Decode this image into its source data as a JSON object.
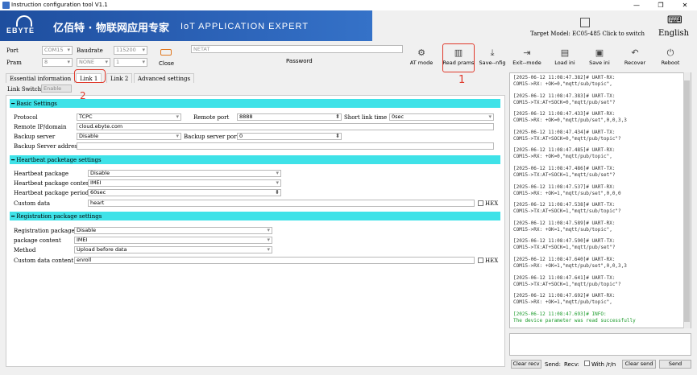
{
  "window": {
    "title": "Instruction configuration tool V1.1",
    "min": "—",
    "max": "❐",
    "close": "✕"
  },
  "banner": {
    "logo_text": "EBYTE",
    "cn_name": "亿佰特 · 物联网应用专家",
    "en_slogan": "IoT APPLICATION EXPERT"
  },
  "header": {
    "target_model": "Target Model: EC05-485 Click to switch",
    "language": "English"
  },
  "serial": {
    "port_label": "Port",
    "port_value": "COM15",
    "baud_label": "Baudrate",
    "baud_value": "115200",
    "parity_label": "Pram",
    "parity_value": "8",
    "parity2_value": "NONE",
    "stop_value": "1",
    "close_label": "Close",
    "password_value": "NETAT",
    "password_label": "Password"
  },
  "toolbar": {
    "at_mode": "AT mode",
    "read_params": "Read prams",
    "save_config": "Save--nfig",
    "exit_mode": "Exit--mode",
    "load_ini": "Load ini",
    "save_ini": "Save ini",
    "recover": "Recover",
    "reboot": "Reboot"
  },
  "tabs": {
    "essential": "Essential information",
    "link1": "Link 1",
    "link2": "Link 2",
    "advanced": "Advanced settings"
  },
  "link_switch": {
    "label": "Link Switch",
    "value": "Enable"
  },
  "annotations": {
    "one": "1",
    "two": "2"
  },
  "basic": {
    "title": "Basic Settings",
    "protocol_label": "Protocol",
    "protocol_value": "TCPC",
    "remote_port_label": "Remote port",
    "remote_port_value": "8888",
    "short_link_label": "Short link time",
    "short_link_value": "0sec",
    "remote_ip_label": "Remote IP/domain",
    "remote_ip_value": "cloud.ebyte.com",
    "backup_label": "Backup server",
    "backup_value": "Disable",
    "backup_port_label": "Backup server port",
    "backup_port_value": "0",
    "backup_addr_label": "Backup Server address",
    "backup_addr_value": ""
  },
  "heartbeat": {
    "title": "Heartbeat packetage settings",
    "pkg_label": "Heartbeat package",
    "pkg_value": "Disable",
    "content_label": "Heartbeat package content",
    "content_value": "IMEI",
    "period_label": "Heartbeat package period",
    "period_value": "60sec",
    "custom_label": "Custom data",
    "custom_value": "heart",
    "hex_label": "HEX"
  },
  "registration": {
    "title": "Registration package settings",
    "pkg_label": "Registration package",
    "pkg_value": "Disable",
    "content_label": "package content",
    "content_value": "IMEI",
    "method_label": "Method",
    "method_value": "Upload before data",
    "custom_label": "Custom data content",
    "custom_value": "enroll",
    "hex_label": "HEX"
  },
  "log": [
    {
      "ts": "[2025-06-12 11:08:47.382]# UART-RX:",
      "msg": "COM15->RX: +OK=0,\"mqtt/sub/topic\","
    },
    {
      "ts": "[2025-06-12 11:08:47.383]# UART-TX:",
      "msg": "COM15->TX:AT+SOCK=0,\"mqtt/pub/set\"?"
    },
    {
      "ts": "[2025-06-12 11:08:47.433]# UART-RX:",
      "msg": "COM15->RX: +OK=0,\"mqtt/pub/set\",0,0,3,3"
    },
    {
      "ts": "[2025-06-12 11:08:47.434]# UART-TX:",
      "msg": "COM15->TX:AT+SOCK=0,\"mqtt/pub/topic\"?"
    },
    {
      "ts": "[2025-06-12 11:08:47.485]# UART-RX:",
      "msg": "COM15->RX: +OK=0,\"mqtt/pub/topic\","
    },
    {
      "ts": "[2025-06-12 11:08:47.486]# UART-TX:",
      "msg": "COM15->TX:AT+SOCK=1,\"mqtt/sub/set\"?"
    },
    {
      "ts": "[2025-06-12 11:08:47.537]# UART-RX:",
      "msg": "COM15->RX: +OK=1,\"mqtt/sub/set\",0,0,0"
    },
    {
      "ts": "[2025-06-12 11:08:47.538]# UART-TX:",
      "msg": "COM15->TX:AT+SOCK=1,\"mqtt/sub/topic\"?"
    },
    {
      "ts": "[2025-06-12 11:08:47.589]# UART-RX:",
      "msg": "COM15->RX: +OK=1,\"mqtt/sub/topic\","
    },
    {
      "ts": "[2025-06-12 11:08:47.590]# UART-TX:",
      "msg": "COM15->TX:AT+SOCK=1,\"mqtt/pub/set\"?"
    },
    {
      "ts": "[2025-06-12 11:08:47.640]# UART-RX:",
      "msg": "COM15->RX: +OK=1,\"mqtt/pub/set\",0,0,3,3"
    },
    {
      "ts": "[2025-06-12 11:08:47.641]# UART-TX:",
      "msg": "COM15->TX:AT+SOCK=1,\"mqtt/pub/topic\"?"
    },
    {
      "ts": "[2025-06-12 11:08:47.692]# UART-RX:",
      "msg": "COM15->RX: +OK=1,\"mqtt/pub/topic\","
    },
    {
      "ts": "[2025-06-12 11:08:47.693]# INFO:",
      "msg": "The device parameter was read successfully"
    }
  ],
  "bottom": {
    "clear_recv": "Clear recv",
    "send_label": "Send:",
    "recv_label": "Recv:",
    "with_rn": "With /r/n",
    "clear_send": "Clear send",
    "send_btn": "Send"
  },
  "colors": {
    "section": "#3fe2e8",
    "banner": "#2c63b8",
    "highlight": "#e0392b",
    "success": "#1a9b2a"
  }
}
